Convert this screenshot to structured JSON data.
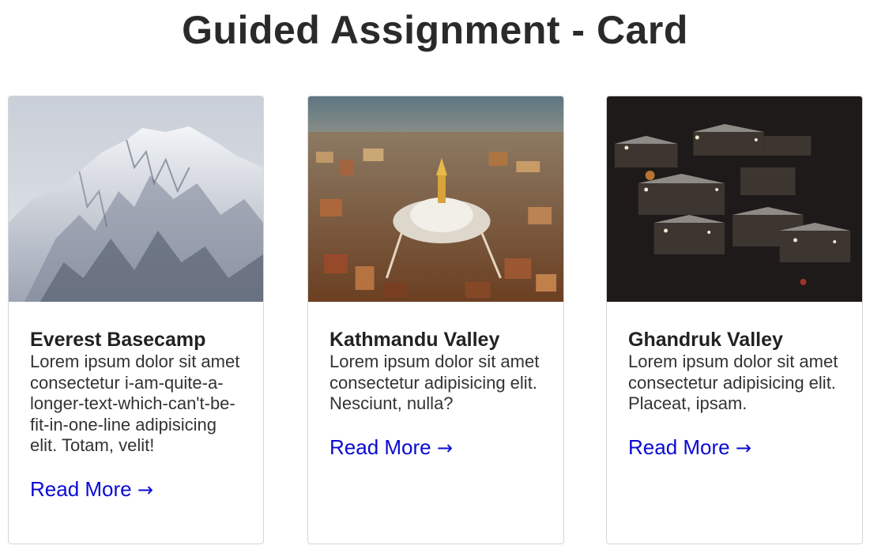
{
  "page": {
    "title": "Guided Assignment - Card"
  },
  "cards": [
    {
      "title": "Everest Basecamp",
      "text": "Lorem ipsum dolor sit amet consectetur i-am-quite-a-longer-text-which-can't-be-fit-in-one-line adipisicing elit. Totam, velit!",
      "link_label": "Read More",
      "link_arrow": "→",
      "image": "snowy-mountain-photo"
    },
    {
      "title": "Kathmandu Valley",
      "text": "Lorem ipsum dolor sit amet consectetur adipisicing elit. Nesciunt, nulla?",
      "link_label": "Read More",
      "link_arrow": "→",
      "image": "stupa-city-aerial-photo"
    },
    {
      "title": "Ghandruk Valley",
      "text": "Lorem ipsum dolor sit amet consectetur adipisicing elit. Placeat, ipsam.",
      "link_label": "Read More",
      "link_arrow": "→",
      "image": "night-village-photo"
    }
  ],
  "colors": {
    "link": "#0a0ad2",
    "border": "#d6d6d6",
    "title": "#2a2a2a"
  }
}
